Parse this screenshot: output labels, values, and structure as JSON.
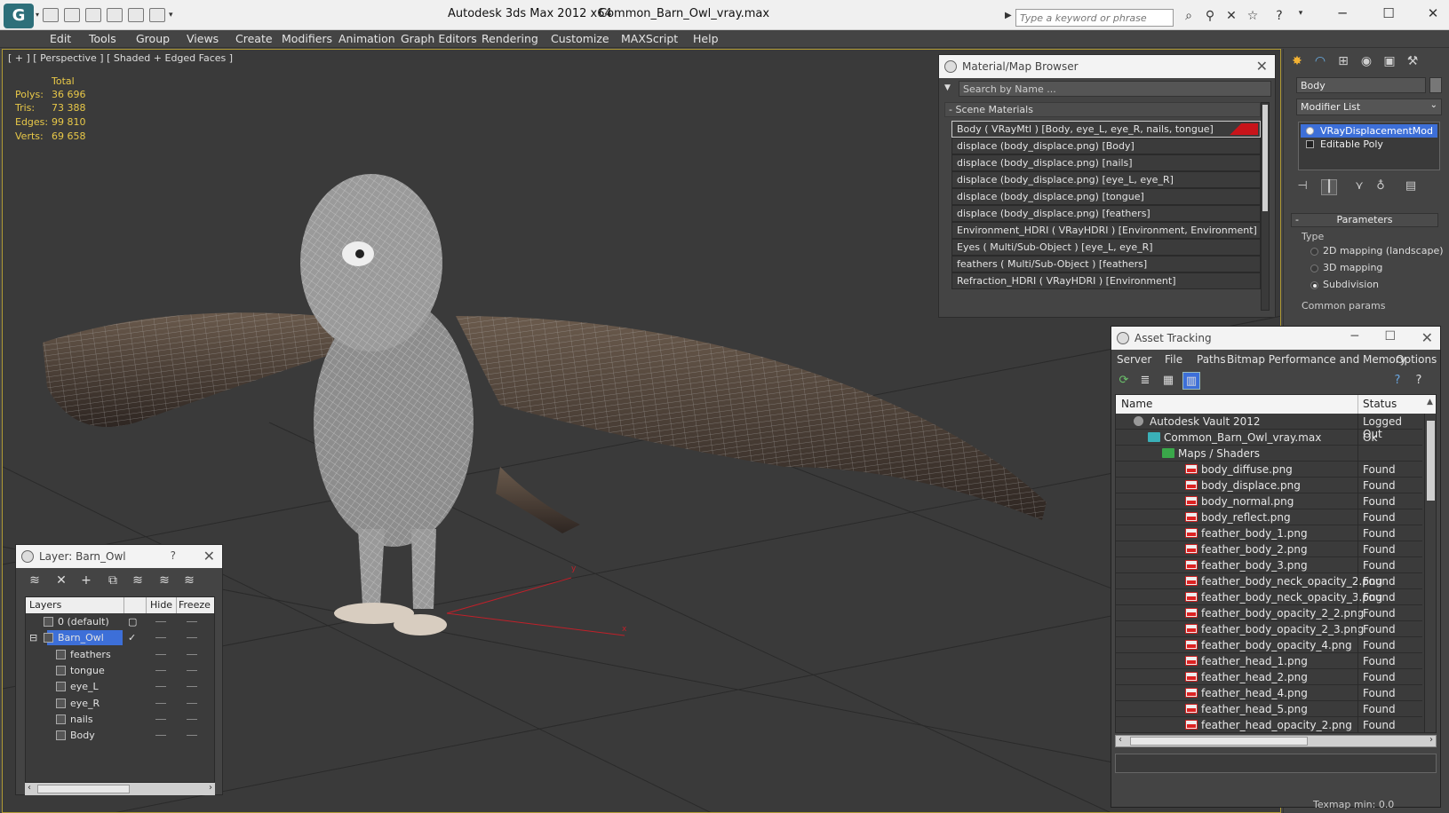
{
  "title_bar": {
    "app_title": "Autodesk 3ds Max  2012 x64",
    "file_title": "Common_Barn_Owl_vray.max",
    "search_placeholder": "Type a keyword or phrase"
  },
  "menu": [
    "Edit",
    "Tools",
    "Group",
    "Views",
    "Create",
    "Modifiers",
    "Animation",
    "Graph Editors",
    "Rendering",
    "Customize",
    "MAXScript",
    "Help"
  ],
  "viewport": {
    "label": "[ + ] [ Perspective ] [ Shaded + Edged Faces ]",
    "stats_header": "Total",
    "stats": [
      {
        "label": "Polys:",
        "value": "36 696"
      },
      {
        "label": "Tris:",
        "value": "73 388"
      },
      {
        "label": "Edges:",
        "value": "99 810"
      },
      {
        "label": "Verts:",
        "value": "69 658"
      }
    ],
    "axis_x": "x",
    "axis_y": "y"
  },
  "material_browser": {
    "title": "Material/Map Browser",
    "search_placeholder": "Search by Name ...",
    "section": "Scene Materials",
    "items": [
      "Body  ( VRayMtl )  [Body, eye_L, eye_R, nails, tongue]",
      "displace (body_displace.png) [Body]",
      "displace (body_displace.png) [nails]",
      "displace (body_displace.png) [eye_L, eye_R]",
      "displace (body_displace.png) [tongue]",
      "displace (body_displace.png) [feathers]",
      "Environment_HDRI  ( VRayHDRI )  [Environment, Environment]",
      "Eyes  ( Multi/Sub-Object )  [eye_L, eye_R]",
      "feathers  ( Multi/Sub-Object )  [feathers]",
      "Refraction_HDRI  ( VRayHDRI )  [Environment]"
    ]
  },
  "command_panel": {
    "object_name": "Body",
    "modifier_list": "Modifier List",
    "stack": [
      "VRayDisplacementMod",
      "Editable Poly"
    ],
    "params_title": "Parameters",
    "type_label": "Type",
    "type_options": [
      "2D mapping (landscape)",
      "3D mapping",
      "Subdivision"
    ],
    "type_selected": "Subdivision",
    "common_params": "Common params",
    "texmap_min": "Texmap min: 0.0"
  },
  "asset_tracking": {
    "title": "Asset Tracking",
    "menu": [
      "Server",
      "File",
      "Paths",
      "Bitmap Performance and Memory",
      "Options"
    ],
    "col_name": "Name",
    "col_status": "Status",
    "rows": [
      {
        "name": "Autodesk Vault 2012",
        "status": "Logged Out",
        "level": 0,
        "icon": "vault-icon"
      },
      {
        "name": "Common_Barn_Owl_vray.max",
        "status": "Ok",
        "level": 1,
        "icon": "max-file-icon"
      },
      {
        "name": "Maps / Shaders",
        "status": "",
        "level": 2,
        "icon": "maps-folder-icon"
      },
      {
        "name": "body_diffuse.png",
        "status": "Found",
        "level": 3,
        "icon": "png-icon"
      },
      {
        "name": "body_displace.png",
        "status": "Found",
        "level": 3,
        "icon": "png-icon"
      },
      {
        "name": "body_normal.png",
        "status": "Found",
        "level": 3,
        "icon": "png-icon"
      },
      {
        "name": "body_reflect.png",
        "status": "Found",
        "level": 3,
        "icon": "png-icon"
      },
      {
        "name": "feather_body_1.png",
        "status": "Found",
        "level": 3,
        "icon": "png-icon"
      },
      {
        "name": "feather_body_2.png",
        "status": "Found",
        "level": 3,
        "icon": "png-icon"
      },
      {
        "name": "feather_body_3.png",
        "status": "Found",
        "level": 3,
        "icon": "png-icon"
      },
      {
        "name": "feather_body_neck_opacity_2.png",
        "status": "Found",
        "level": 3,
        "icon": "png-icon"
      },
      {
        "name": "feather_body_neck_opacity_3.png",
        "status": "Found",
        "level": 3,
        "icon": "png-icon"
      },
      {
        "name": "feather_body_opacity_2_2.png",
        "status": "Found",
        "level": 3,
        "icon": "png-icon"
      },
      {
        "name": "feather_body_opacity_2_3.png",
        "status": "Found",
        "level": 3,
        "icon": "png-icon"
      },
      {
        "name": "feather_body_opacity_4.png",
        "status": "Found",
        "level": 3,
        "icon": "png-icon"
      },
      {
        "name": "feather_head_1.png",
        "status": "Found",
        "level": 3,
        "icon": "png-icon"
      },
      {
        "name": "feather_head_2.png",
        "status": "Found",
        "level": 3,
        "icon": "png-icon"
      },
      {
        "name": "feather_head_4.png",
        "status": "Found",
        "level": 3,
        "icon": "png-icon"
      },
      {
        "name": "feather_head_5.png",
        "status": "Found",
        "level": 3,
        "icon": "png-icon"
      },
      {
        "name": "feather_head_opacity_2.png",
        "status": "Found",
        "level": 3,
        "icon": "png-icon"
      }
    ]
  },
  "layer_panel": {
    "title": "Layer: Barn_Owl",
    "help": "?",
    "col_layers": "Layers",
    "col_hide": "Hide",
    "col_freeze": "Freeze",
    "rows": [
      {
        "name": "0 (default)",
        "level": 0
      },
      {
        "name": "Barn_Owl",
        "level": 0,
        "selected": true
      },
      {
        "name": "feathers",
        "level": 1
      },
      {
        "name": "tongue",
        "level": 1
      },
      {
        "name": "eye_L",
        "level": 1
      },
      {
        "name": "eye_R",
        "level": 1
      },
      {
        "name": "nails",
        "level": 1
      },
      {
        "name": "Body",
        "level": 1
      }
    ]
  },
  "colors": {
    "selection": "#3d6fd8",
    "stats": "#e8c848",
    "viewport_border": "#b09a34",
    "material_swatch": "#c8141a"
  }
}
